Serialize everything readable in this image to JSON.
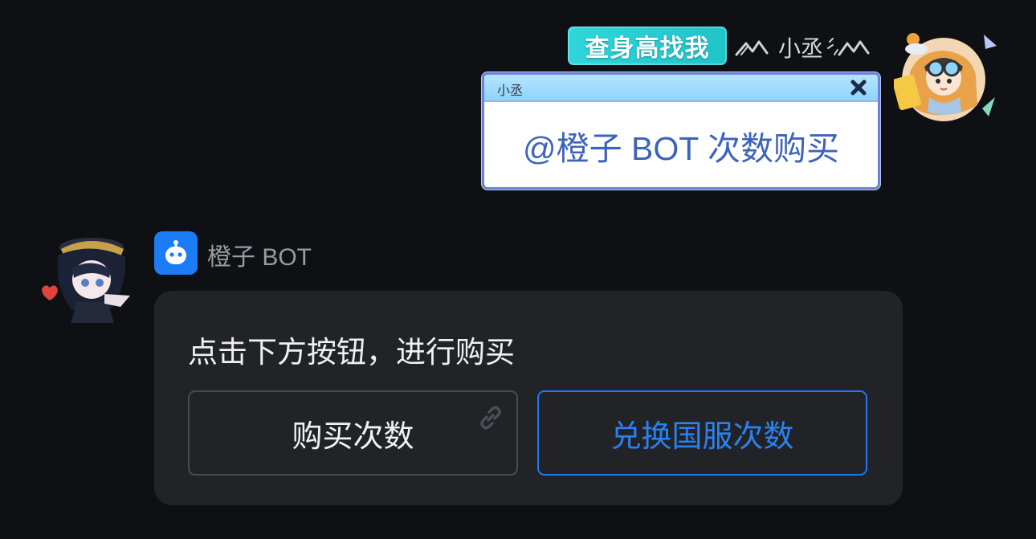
{
  "outgoing": {
    "title_badge": "查身高找我",
    "sender_name": "小丞",
    "window": {
      "title": "小丞",
      "message": "@橙子 BOT 次数购买"
    }
  },
  "bot": {
    "name": "橙子 BOT",
    "card": {
      "text": "点击下方按钮，进行购买",
      "buttons": [
        {
          "label": "购买次数",
          "icon": "link-icon"
        },
        {
          "label": "兑换国服次数"
        }
      ]
    }
  },
  "colors": {
    "background": "#0f1013",
    "card": "#222326",
    "accent_blue": "#1f78ef",
    "bot_icon": "#1c7cf5",
    "badge_cyan": "#2fd6dc",
    "window_border": "#6b82d8",
    "window_text": "#3d64b8"
  }
}
